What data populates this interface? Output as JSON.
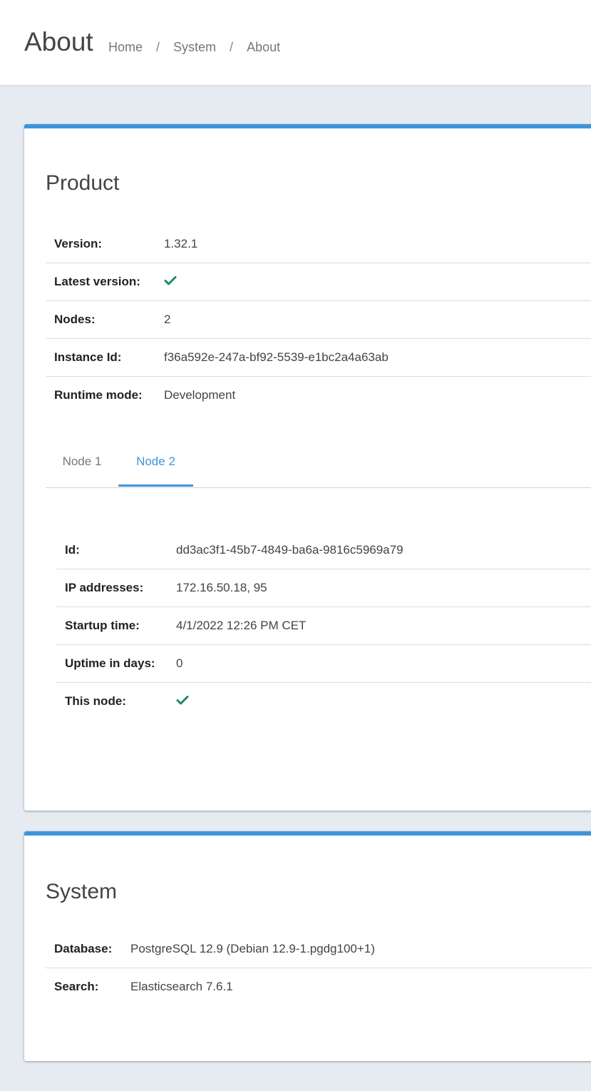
{
  "header": {
    "title": "About",
    "breadcrumb": [
      "Home",
      "System",
      "About"
    ],
    "separator": "/"
  },
  "product": {
    "title": "Product",
    "rows": [
      {
        "label": "Version:",
        "value": "1.32.1"
      },
      {
        "label": "Latest version:",
        "value": "",
        "icon": "check-icon"
      },
      {
        "label": "Nodes:",
        "value": "2"
      },
      {
        "label": "Instance Id:",
        "value": "f36a592e-247a-bf92-5539-e1bc2a4a63ab"
      },
      {
        "label": "Runtime mode:",
        "value": "Development"
      }
    ],
    "tabs": [
      {
        "label": "Node 1",
        "active": false
      },
      {
        "label": "Node 2",
        "active": true
      }
    ],
    "node": {
      "rows": [
        {
          "label": "Id:",
          "value": "dd3ac3f1-45b7-4849-ba6a-9816c5969a79"
        },
        {
          "label": "IP addresses:",
          "value": "172.16.50.18, 95"
        },
        {
          "label": "Startup time:",
          "value": "4/1/2022 12:26 PM CET"
        },
        {
          "label": "Uptime in days:",
          "value": "0"
        },
        {
          "label": "This node:",
          "value": "",
          "icon": "check-icon"
        }
      ]
    }
  },
  "system": {
    "title": "System",
    "rows": [
      {
        "label": "Database:",
        "value": "PostgreSQL 12.9 (Debian 12.9-1.pgdg100+1)"
      },
      {
        "label": "Search:",
        "value": "Elasticsearch 7.6.1"
      }
    ]
  },
  "colors": {
    "accent": "#3d96dc",
    "check": "#1e8a6a",
    "background": "#e6ebf2"
  }
}
